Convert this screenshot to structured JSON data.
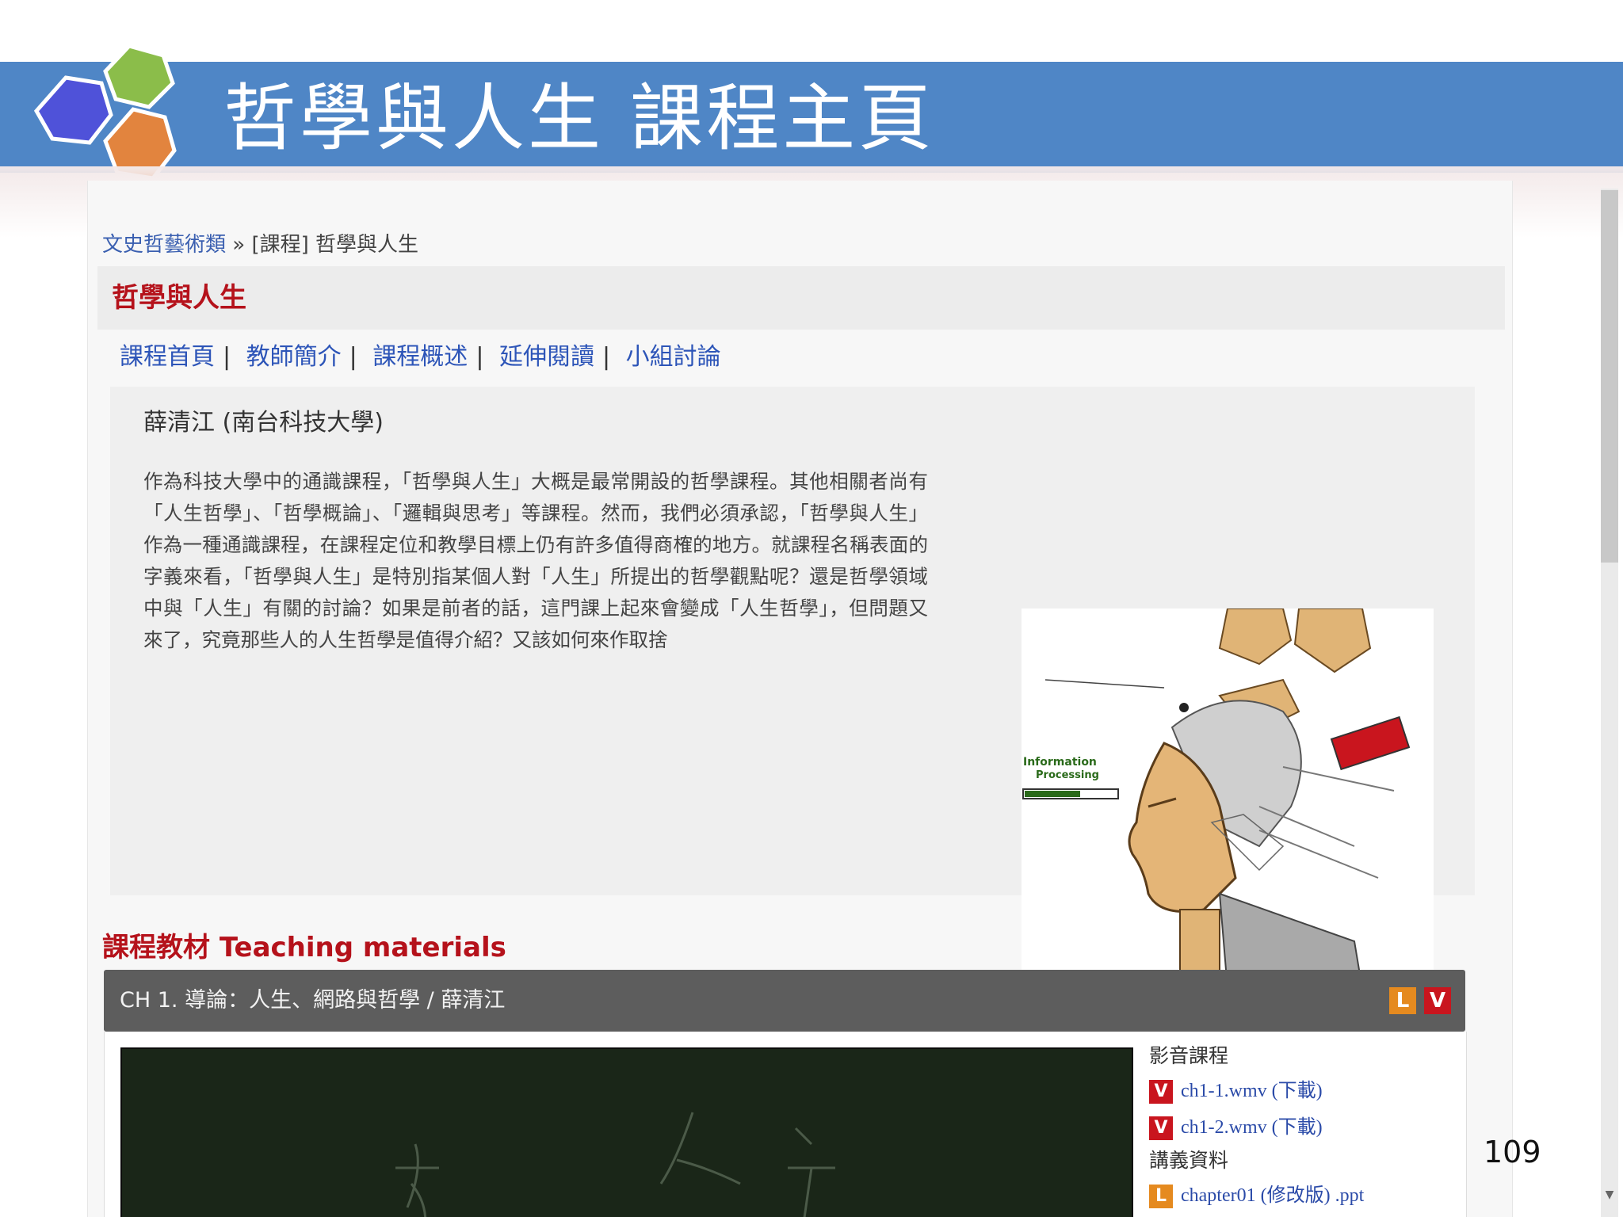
{
  "slide": {
    "title": "哲學與人生 課程主頁",
    "page_number": "109"
  },
  "colors": {
    "title_band": "#4f86c6",
    "accent_red": "#b5121b",
    "link_blue": "#2d55b8"
  },
  "breadcrumb": {
    "parent": "文史哲藝術類",
    "separator": "»",
    "current": "[課程] 哲學與人生"
  },
  "course": {
    "title": "哲學與人生",
    "nav": [
      "課程首頁",
      "教師簡介",
      "課程概述",
      "延伸閱讀",
      "小組討論"
    ],
    "nav_separator": "|",
    "teacher": "薛清江 (南台科技大學)",
    "description": "作為科技大學中的通識課程，「哲學與人生」大概是最常開設的哲學課程。其他相關者尚有「人生哲學」、「哲學概論」、「邏輯與思考」等課程。然而，我們必須承認，「哲學與人生」作為一種通識課程，在課程定位和教學目標上仍有許多值得商榷的地方。就課程名稱表面的字義來看，「哲學與人生」是特別指某個人對「人生」所提出的哲學觀點呢？還是哲學領域中與「人生」有關的討論？如果是前者的話，這門課上起來會變成「人生哲學」，但問題又來了，究竟那些人的人生哲學是值得介紹？又該如何來作取捨",
    "image_icon": "robot-head-illustration"
  },
  "materials": {
    "title": "課程教材 Teaching materials",
    "chapter": {
      "title": "CH 1. 導論：人生、網路與哲學 / 薛清江",
      "badges": [
        "L",
        "V"
      ]
    },
    "video_section_label": "影音課程",
    "videos": [
      {
        "badge": "V",
        "label": "ch1-1.wmv (下載)"
      },
      {
        "badge": "V",
        "label": "ch1-2.wmv (下載)"
      }
    ],
    "notes_section_label": "講義資料",
    "notes": [
      {
        "badge": "L",
        "label": "chapter01 (修改版) .ppt"
      }
    ]
  }
}
